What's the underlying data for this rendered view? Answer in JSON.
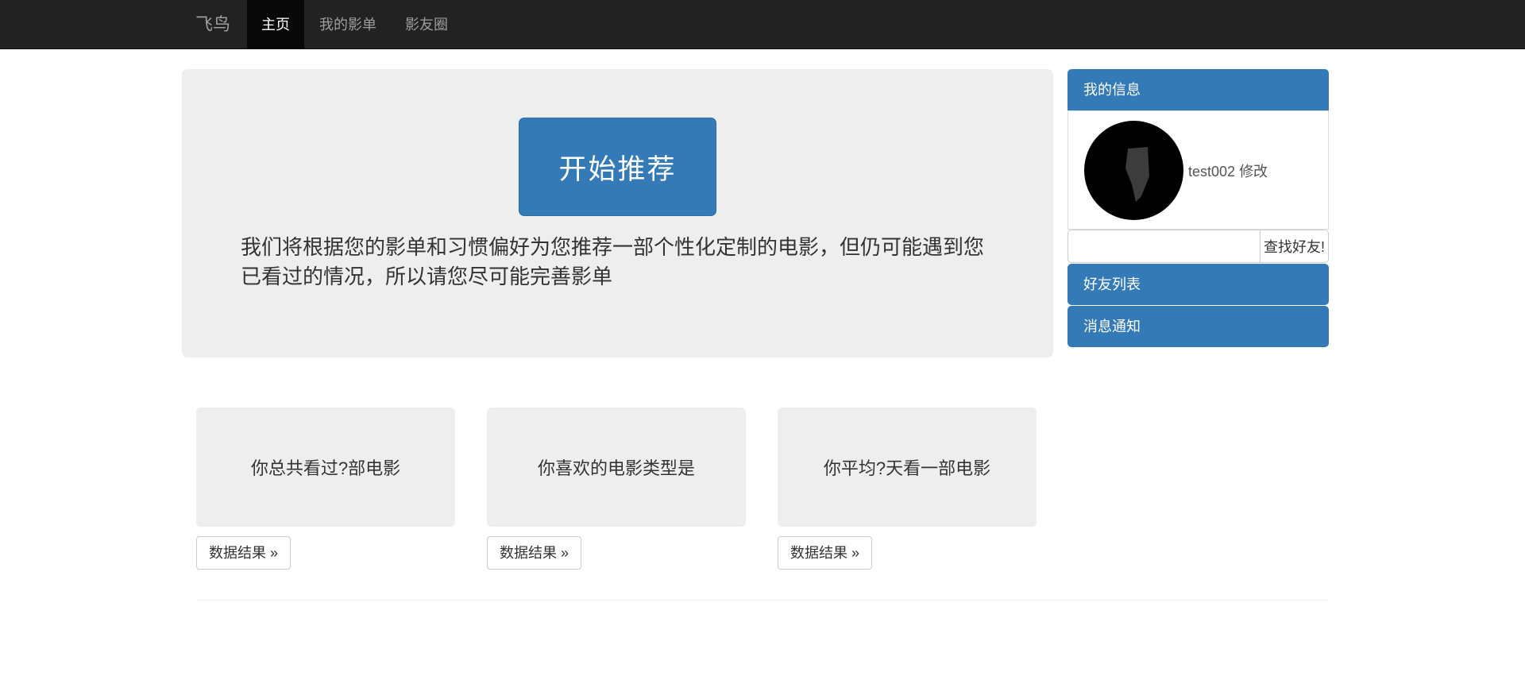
{
  "navbar": {
    "brand": "飞鸟",
    "items": [
      {
        "label": "主页",
        "active": true
      },
      {
        "label": "我的影单"
      },
      {
        "label": "影友圈"
      }
    ]
  },
  "jumbotron": {
    "button_label": "开始推荐",
    "description": "我们将根据您的影单和习惯偏好为您推荐一部个性化定制的电影，但仍可能遇到您已看过的情况，所以请您尽可能完善影单"
  },
  "sidebar": {
    "panel_title": "我的信息",
    "username": "test002",
    "edit_link": "修改",
    "search_placeholder": "",
    "search_button": "查找好友!",
    "friends_list": "好友列表",
    "notifications": "消息通知"
  },
  "cards": [
    {
      "title": "你总共看过?部电影",
      "button": "数据结果 »"
    },
    {
      "title": "你喜欢的电影类型是",
      "button": "数据结果 »"
    },
    {
      "title": "你平均?天看一部电影",
      "button": "数据结果 »"
    }
  ]
}
